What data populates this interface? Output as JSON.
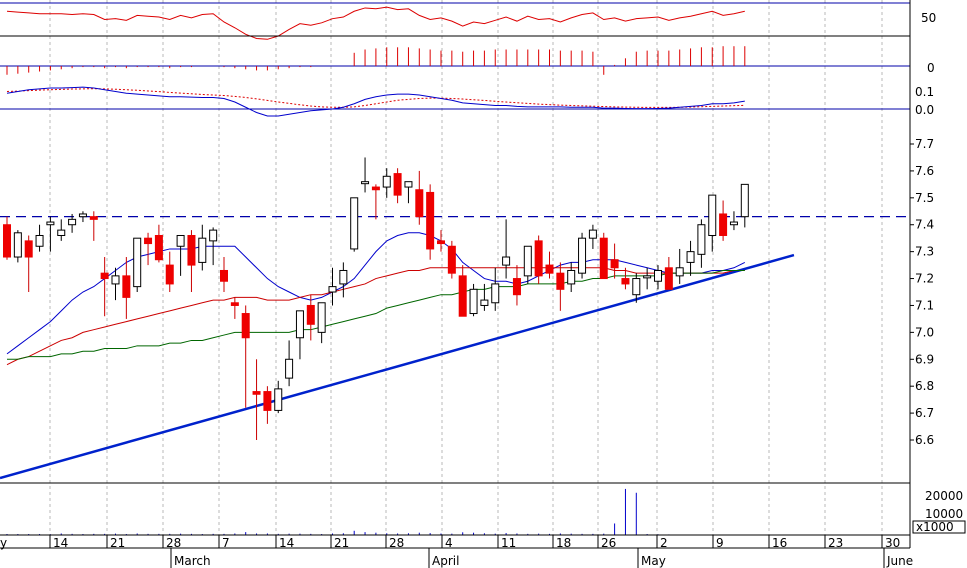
{
  "chart_data": {
    "type": "candlestick",
    "x_day_labels": [
      "14",
      "21",
      "28",
      "7",
      "14",
      "21",
      "28",
      "4",
      "11",
      "18",
      "26",
      "2",
      "9",
      "16",
      "23",
      "30"
    ],
    "x_month_labels": [
      "March",
      "April",
      "May",
      "June"
    ],
    "price_axis": {
      "ticks": [
        "7.7",
        "7.6",
        "7.5",
        "7.4",
        "7.3",
        "7.2",
        "7.1",
        "7.0",
        "6.9",
        "6.8",
        "6.7",
        "6.6"
      ],
      "ylim": [
        6.52,
        7.82
      ]
    },
    "rsi_panel": {
      "ticks": [
        "50"
      ],
      "upper_line": 70,
      "lower_line": 30
    },
    "momentum_panel": {
      "ticks": [
        "0"
      ]
    },
    "macd_panel": {
      "ticks": [
        "0.1",
        "0.0"
      ]
    },
    "volume_panel": {
      "ticks": [
        "20000",
        "10000"
      ],
      "unit_label": "x1000"
    },
    "resistance_level": 7.43,
    "trendline": {
      "from": [
        0,
        6.54
      ],
      "to": [
        67,
        7.25
      ]
    },
    "candles": [
      [
        7.4,
        7.43,
        7.27,
        7.28
      ],
      [
        7.28,
        7.38,
        7.26,
        7.37
      ],
      [
        7.34,
        7.36,
        7.15,
        7.28
      ],
      [
        7.32,
        7.4,
        7.3,
        7.36
      ],
      [
        7.4,
        7.43,
        7.3,
        7.41
      ],
      [
        7.36,
        7.42,
        7.34,
        7.38
      ],
      [
        7.4,
        7.44,
        7.37,
        7.42
      ],
      [
        7.43,
        7.45,
        7.41,
        7.44
      ],
      [
        7.43,
        7.45,
        7.34,
        7.42
      ],
      [
        7.22,
        7.28,
        7.06,
        7.2
      ],
      [
        7.18,
        7.24,
        7.12,
        7.21
      ],
      [
        7.21,
        7.28,
        7.05,
        7.13
      ],
      [
        7.17,
        7.34,
        7.15,
        7.35
      ],
      [
        7.35,
        7.37,
        7.25,
        7.33
      ],
      [
        7.36,
        7.4,
        7.26,
        7.27
      ],
      [
        7.25,
        7.3,
        7.15,
        7.18
      ],
      [
        7.32,
        7.36,
        7.21,
        7.36
      ],
      [
        7.36,
        7.38,
        7.15,
        7.25
      ],
      [
        7.26,
        7.4,
        7.23,
        7.35
      ],
      [
        7.34,
        7.39,
        7.25,
        7.38
      ],
      [
        7.23,
        7.28,
        7.15,
        7.19
      ],
      [
        7.11,
        7.13,
        7.05,
        7.1
      ],
      [
        7.07,
        7.1,
        6.72,
        6.98
      ],
      [
        6.78,
        6.9,
        6.6,
        6.77
      ],
      [
        6.78,
        6.8,
        6.66,
        6.71
      ],
      [
        6.71,
        6.82,
        6.7,
        6.79
      ],
      [
        6.83,
        6.97,
        6.8,
        6.9
      ],
      [
        6.98,
        7.05,
        6.9,
        7.08
      ],
      [
        7.1,
        7.14,
        6.97,
        7.03
      ],
      [
        7.0,
        7.1,
        6.96,
        7.11
      ],
      [
        7.15,
        7.24,
        7.1,
        7.17
      ],
      [
        7.18,
        7.26,
        7.13,
        7.23
      ],
      [
        7.31,
        7.5,
        7.3,
        7.5
      ],
      [
        7.56,
        7.65,
        7.52,
        7.56
      ],
      [
        7.54,
        7.55,
        7.42,
        7.53
      ],
      [
        7.54,
        7.61,
        7.5,
        7.58
      ],
      [
        7.59,
        7.61,
        7.48,
        7.51
      ],
      [
        7.54,
        7.56,
        7.48,
        7.56
      ],
      [
        7.53,
        7.6,
        7.4,
        7.43
      ],
      [
        7.52,
        7.55,
        7.27,
        7.31
      ],
      [
        7.34,
        7.38,
        7.3,
        7.33
      ],
      [
        7.32,
        7.34,
        7.2,
        7.22
      ],
      [
        7.21,
        7.25,
        7.06,
        7.06
      ],
      [
        7.07,
        7.18,
        7.06,
        7.16
      ],
      [
        7.1,
        7.18,
        7.08,
        7.12
      ],
      [
        7.11,
        7.24,
        7.08,
        7.18
      ],
      [
        7.25,
        7.42,
        7.2,
        7.28
      ],
      [
        7.2,
        7.25,
        7.1,
        7.14
      ],
      [
        7.21,
        7.32,
        7.18,
        7.32
      ],
      [
        7.34,
        7.36,
        7.18,
        7.21
      ],
      [
        7.25,
        7.3,
        7.2,
        7.22
      ],
      [
        7.22,
        7.26,
        7.08,
        7.16
      ],
      [
        7.18,
        7.26,
        7.15,
        7.23
      ],
      [
        7.22,
        7.37,
        7.2,
        7.35
      ],
      [
        7.35,
        7.4,
        7.31,
        7.38
      ],
      [
        7.35,
        7.37,
        7.23,
        7.2
      ],
      [
        7.27,
        7.33,
        7.2,
        7.24
      ],
      [
        7.2,
        7.24,
        7.16,
        7.18
      ],
      [
        7.14,
        7.22,
        7.11,
        7.2
      ],
      [
        7.21,
        7.24,
        7.16,
        7.21
      ],
      [
        7.19,
        7.25,
        7.16,
        7.23
      ],
      [
        7.24,
        7.28,
        7.17,
        7.16
      ],
      [
        7.21,
        7.31,
        7.18,
        7.24
      ],
      [
        7.26,
        7.34,
        7.21,
        7.3
      ],
      [
        7.29,
        7.42,
        7.24,
        7.4
      ],
      [
        7.36,
        7.5,
        7.3,
        7.51
      ],
      [
        7.44,
        7.49,
        7.34,
        7.36
      ],
      [
        7.4,
        7.45,
        7.38,
        7.41
      ],
      [
        7.43,
        7.55,
        7.39,
        7.55
      ]
    ],
    "series": [
      {
        "values": [
          6.92,
          6.95,
          6.98,
          7.01,
          7.04,
          7.08,
          7.12,
          7.15,
          7.17,
          7.2,
          7.23,
          7.26,
          7.28,
          7.29,
          7.3,
          7.31,
          7.31,
          7.31,
          7.32,
          7.32,
          7.32,
          7.32,
          7.28,
          7.24,
          7.2,
          7.17,
          7.15,
          7.13,
          7.12,
          7.13,
          7.15,
          7.17,
          7.2,
          7.25,
          7.3,
          7.34,
          7.36,
          7.37,
          7.37,
          7.36,
          7.34,
          7.31,
          7.26,
          7.23,
          7.2,
          7.19,
          7.19,
          7.18,
          7.19,
          7.21,
          7.23,
          7.25,
          7.26,
          7.26,
          7.27,
          7.27,
          7.27,
          7.26,
          7.25,
          7.24,
          7.23,
          7.22,
          7.22,
          7.22,
          7.22,
          7.23,
          7.23,
          7.24,
          7.26
        ]
      },
      {
        "values": [
          6.88,
          6.9,
          6.91,
          6.93,
          6.95,
          6.97,
          6.98,
          7.0,
          7.01,
          7.02,
          7.03,
          7.04,
          7.05,
          7.06,
          7.07,
          7.08,
          7.09,
          7.1,
          7.11,
          7.12,
          7.12,
          7.13,
          7.13,
          7.13,
          7.12,
          7.12,
          7.12,
          7.13,
          7.14,
          7.14,
          7.15,
          7.16,
          7.17,
          7.18,
          7.2,
          7.21,
          7.22,
          7.23,
          7.23,
          7.24,
          7.24,
          7.24,
          7.24,
          7.24,
          7.24,
          7.24,
          7.24,
          7.24,
          7.24,
          7.24,
          7.24,
          7.24,
          7.24,
          7.24,
          7.24,
          7.24,
          7.23,
          7.23,
          7.22,
          7.22,
          7.22,
          7.22,
          7.22,
          7.22,
          7.22,
          7.22,
          7.22,
          7.23,
          7.23
        ]
      },
      {
        "values": [
          6.9,
          6.9,
          6.91,
          6.91,
          6.91,
          6.92,
          6.92,
          6.93,
          6.93,
          6.94,
          6.94,
          6.94,
          6.95,
          6.95,
          6.95,
          6.96,
          6.96,
          6.97,
          6.97,
          6.98,
          6.99,
          7.0,
          7.0,
          7.0,
          7.0,
          7.0,
          7.0,
          7.01,
          7.01,
          7.02,
          7.03,
          7.04,
          7.05,
          7.06,
          7.07,
          7.09,
          7.1,
          7.11,
          7.12,
          7.13,
          7.14,
          7.14,
          7.15,
          7.16,
          7.16,
          7.17,
          7.17,
          7.17,
          7.18,
          7.18,
          7.18,
          7.18,
          7.19,
          7.19,
          7.2,
          7.2,
          7.21,
          7.21,
          7.21,
          7.21,
          7.21,
          7.22,
          7.22,
          7.22,
          7.22,
          7.22,
          7.23,
          7.23,
          7.23
        ]
      }
    ],
    "rsi": [
      60,
      59,
      58,
      57,
      57,
      57,
      56,
      57,
      56,
      50,
      51,
      49,
      55,
      54,
      53,
      50,
      55,
      52,
      56,
      57,
      47,
      40,
      32,
      27,
      26,
      30,
      38,
      45,
      43,
      46,
      51,
      53,
      60,
      64,
      63,
      65,
      62,
      63,
      55,
      50,
      52,
      48,
      42,
      47,
      45,
      49,
      53,
      48,
      54,
      50,
      51,
      47,
      52,
      56,
      58,
      50,
      52,
      48,
      51,
      52,
      53,
      49,
      52,
      54,
      57,
      60,
      55,
      57,
      60
    ],
    "momentum": [
      -0.08,
      -0.07,
      -0.06,
      -0.05,
      -0.04,
      -0.03,
      -0.02,
      -0.01,
      -0.01,
      -0.02,
      -0.01,
      -0.02,
      -0.01,
      -0.01,
      -0.01,
      -0.02,
      -0.01,
      -0.01,
      0,
      0,
      -0.01,
      -0.02,
      -0.03,
      -0.04,
      -0.04,
      -0.03,
      -0.02,
      -0.01,
      -0.01,
      0,
      0,
      0,
      0.12,
      0.15,
      0.16,
      0.17,
      0.17,
      0.17,
      0.16,
      0.15,
      0.14,
      0.14,
      0.13,
      0.14,
      0.14,
      0.15,
      0.15,
      0.15,
      0.15,
      0.15,
      0.15,
      0.14,
      0.14,
      0.14,
      0.13,
      -0.08,
      0.01,
      0.07,
      0.13,
      0.14,
      0.14,
      0.14,
      0.15,
      0.16,
      0.17,
      0.17,
      0.18,
      0.18,
      0.18
    ],
    "macd": [
      0.09,
      0.1,
      0.11,
      0.115,
      0.12,
      0.12,
      0.122,
      0.125,
      0.12,
      0.11,
      0.1,
      0.09,
      0.085,
      0.08,
      0.075,
      0.07,
      0.07,
      0.068,
      0.066,
      0.066,
      0.06,
      0.04,
      0.01,
      -0.02,
      -0.04,
      -0.04,
      -0.03,
      -0.02,
      -0.01,
      -0.005,
      0.0,
      0.01,
      0.03,
      0.055,
      0.07,
      0.08,
      0.085,
      0.085,
      0.08,
      0.07,
      0.06,
      0.05,
      0.035,
      0.03,
      0.025,
      0.02,
      0.02,
      0.015,
      0.012,
      0.012,
      0.012,
      0.012,
      0.01,
      0.01,
      0.01,
      0.005,
      0.005,
      0.003,
      0.002,
      0.002,
      0.003,
      0.005,
      0.01,
      0.015,
      0.02,
      0.03,
      0.03,
      0.035,
      0.045
    ],
    "macd_signal": [
      0.1,
      0.102,
      0.105,
      0.108,
      0.11,
      0.112,
      0.114,
      0.115,
      0.116,
      0.115,
      0.113,
      0.11,
      0.107,
      0.103,
      0.099,
      0.095,
      0.091,
      0.087,
      0.083,
      0.08,
      0.077,
      0.072,
      0.066,
      0.058,
      0.049,
      0.04,
      0.032,
      0.024,
      0.017,
      0.012,
      0.01,
      0.01,
      0.012,
      0.02,
      0.03,
      0.04,
      0.05,
      0.055,
      0.06,
      0.062,
      0.062,
      0.06,
      0.057,
      0.053,
      0.049,
      0.044,
      0.04,
      0.036,
      0.032,
      0.028,
      0.025,
      0.022,
      0.02,
      0.018,
      0.016,
      0.014,
      0.012,
      0.011,
      0.01,
      0.009,
      0.009,
      0.009,
      0.01,
      0.011,
      0.013,
      0.015,
      0.017,
      0.019,
      0.021
    ],
    "volume": [
      500,
      500,
      500,
      500,
      400,
      800,
      600,
      500,
      600,
      600,
      700,
      500,
      800,
      600,
      600,
      600,
      700,
      600,
      500,
      600,
      600,
      800,
      1500,
      800,
      800,
      600,
      700,
      700,
      600,
      500,
      800,
      900,
      2200,
      1500,
      1200,
      900,
      800,
      900,
      1200,
      1000,
      800,
      700,
      1400,
      1200,
      900,
      700,
      1000,
      800,
      600,
      700,
      600,
      800,
      700,
      600,
      600,
      700,
      6000,
      24000,
      22000,
      500,
      400,
      300,
      200,
      100,
      100,
      100,
      100,
      100,
      100
    ]
  }
}
